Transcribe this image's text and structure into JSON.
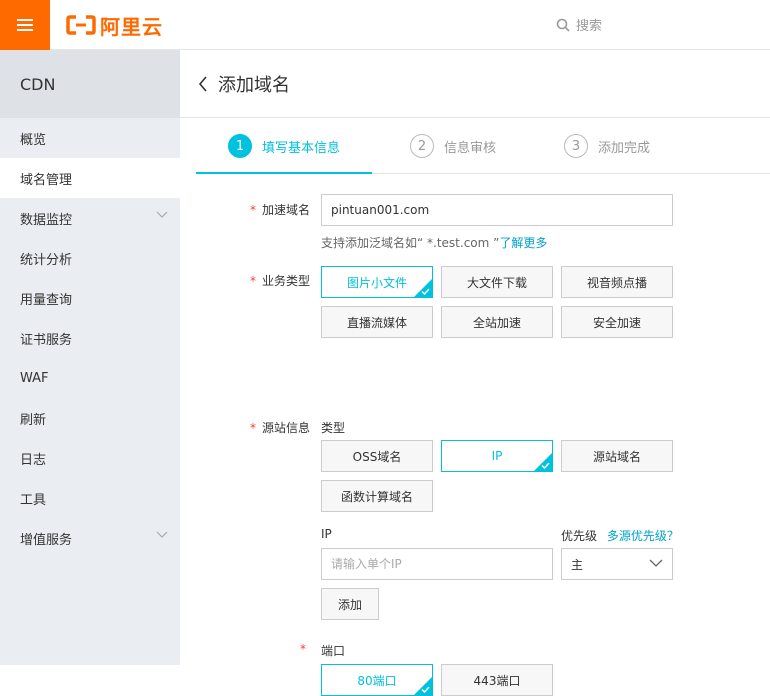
{
  "brand": {
    "name": "阿里云",
    "color": "#ff6a00"
  },
  "header": {
    "search_label": "搜索",
    "menu_icon": "hamburger-icon"
  },
  "sidebar": {
    "title": "CDN",
    "items": [
      {
        "label": "概览"
      },
      {
        "label": "域名管理",
        "active": true
      },
      {
        "label": "数据监控",
        "expandable": true
      },
      {
        "label": "统计分析"
      },
      {
        "label": "用量查询"
      },
      {
        "label": "证书服务"
      },
      {
        "label": "WAF"
      },
      {
        "label": "刷新"
      },
      {
        "label": "日志"
      },
      {
        "label": "工具"
      },
      {
        "label": "增值服务",
        "expandable": true
      }
    ]
  },
  "page": {
    "title": "添加域名"
  },
  "steps": [
    {
      "num": "1",
      "label": "填写基本信息",
      "active": true
    },
    {
      "num": "2",
      "label": "信息审核"
    },
    {
      "num": "3",
      "label": "添加完成"
    }
  ],
  "form": {
    "domain": {
      "label": "加速域名",
      "value": "pintuan001.com",
      "hint_text": "支持添加泛域名如“ *.test.com ”",
      "hint_link": "了解更多"
    },
    "business_type": {
      "label": "业务类型",
      "options": [
        "图片小文件",
        "大文件下载",
        "视音频点播",
        "直播流媒体",
        "全站加速",
        "安全加速"
      ],
      "selected": "图片小文件"
    },
    "origin": {
      "label": "源站信息",
      "type_label": "类型",
      "types": [
        "OSS域名",
        "IP",
        "源站域名",
        "函数计算域名"
      ],
      "selected": "IP",
      "ip_label": "IP",
      "ip_placeholder": "请输入单个IP",
      "priority_label": "优先级",
      "priority_link": "多源优先级？",
      "priority_value": "主",
      "add_label": "添加"
    },
    "port": {
      "label": "端口",
      "options": [
        "80端口",
        "443端口"
      ],
      "selected": "80端口"
    }
  },
  "colors": {
    "accent": "#00c1de",
    "required": "#ff3b30",
    "link": "#00a2ca"
  }
}
